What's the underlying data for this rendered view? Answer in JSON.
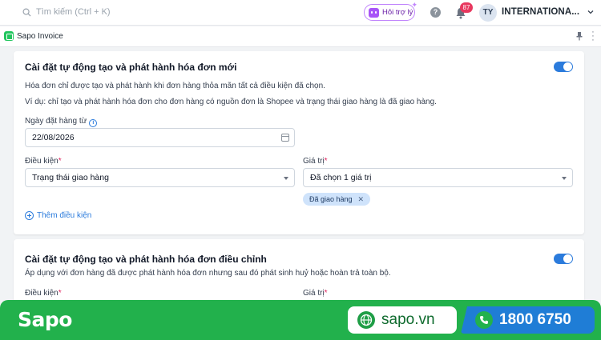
{
  "topbar": {
    "search_placeholder": "Tìm kiếm (Ctrl + K)",
    "help_label": "Hỏi trợ lý",
    "notification_count": "87",
    "avatar_initials": "TY",
    "account_name": "INTERNATIONA..."
  },
  "app": {
    "title": "Sapo Invoice"
  },
  "section1": {
    "title": "Cài đặt tự động tạo và phát hành hóa đơn mới",
    "toggle_on": true,
    "desc1": "Hóa đơn chỉ được tạo và phát hành khi đơn hàng thỏa mãn tất cả điều kiện đã chọn.",
    "desc2": "Ví dụ: chỉ tạo và phát hành hóa đơn cho đơn hàng có nguồn đơn là Shopee và trạng thái giao hàng là đã giao hàng.",
    "date_label": "Ngày đặt hàng từ",
    "date_value": "22/08/2026",
    "condition_label": "Điều kiện",
    "condition_value": "Trạng thái giao hàng",
    "value_label": "Giá trị",
    "value_value": "Đã chọn 1 giá trị",
    "chip": "Đã giao hàng",
    "add_condition": "Thêm điều kiện"
  },
  "section2": {
    "title": "Cài đặt tự động tạo và phát hành hóa đơn điều chỉnh",
    "toggle_on": true,
    "desc": "Áp dụng với đơn hàng đã được phát hành hóa đơn nhưng sau đó phát sinh huỷ hoặc hoàn trả toàn bộ.",
    "condition_label": "Điều kiện",
    "value_label": "Giá trị"
  },
  "banner": {
    "brand": "Sapo",
    "website": "sapo.vn",
    "hotline": "1800 6750"
  },
  "colors": {
    "accent": "#2b7bdc",
    "brand_green": "#22b14c"
  }
}
